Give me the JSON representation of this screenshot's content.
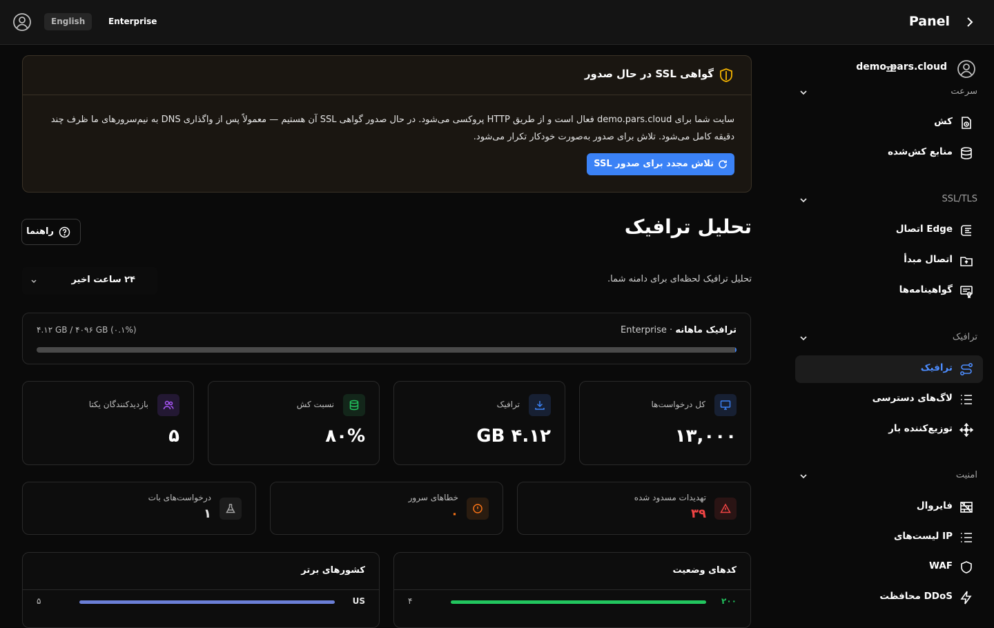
{
  "topbar": {
    "language": "English",
    "plan": "Enterprise",
    "title": "Panel"
  },
  "sidebar": {
    "site": "demo.pars.cloud",
    "sections": [
      {
        "label": "سرعت",
        "items": [
          {
            "label": "کش",
            "icon": "cache-icon"
          },
          {
            "label": "منابع کش‌شده",
            "icon": "database-icon"
          }
        ]
      },
      {
        "label": "SSL/TLS",
        "items": [
          {
            "label": "اتصال Edge",
            "icon": "edge-icon"
          },
          {
            "label": "اتصال مبدأ",
            "icon": "origin-icon"
          },
          {
            "label": "گواهینامه‌ها",
            "icon": "certificate-icon"
          }
        ]
      },
      {
        "label": "ترافیک",
        "items": [
          {
            "label": "ترافیک",
            "icon": "route-icon",
            "active": true
          },
          {
            "label": "لاگ‌های دسترسی",
            "icon": "list-icon"
          },
          {
            "label": "توزیع‌کننده بار",
            "icon": "load-balancer-icon"
          }
        ]
      },
      {
        "label": "امنیت",
        "items": [
          {
            "label": "فایروال",
            "icon": "firewall-icon"
          },
          {
            "label": "لیست‌های IP",
            "icon": "list-icon"
          },
          {
            "label": "WAF",
            "icon": "shield-icon"
          },
          {
            "label": "محافظت DDoS",
            "icon": "bolt-icon"
          }
        ]
      }
    ]
  },
  "banner": {
    "title": "گواهی SSL در حال صدور",
    "text": "سایت شما برای demo.pars.cloud فعال است و از طریق HTTP پروکسی می‌شود. در حال صدور گواهی SSL آن هستیم — معمولاً پس از واگذاری DNS به نیم‌سرورهای ما ظرف چند دقیقه کامل می‌شود. تلاش برای صدور به‌صورت خودکار تکرار می‌شود.",
    "button": "تلاش مجدد برای صدور SSL"
  },
  "page": {
    "title": "تحلیل ترافیک",
    "subtitle": "تحلیل ترافیک لحظه‌ای برای دامنه شما.",
    "guide": "راهنما",
    "range": "۲۴ ساعت اخیر"
  },
  "usage": {
    "title": "ترافیک ماهانه",
    "plan": "Enterprise",
    "value": "۴.۱۲ GB / ۴۰۹۶ GB (۰.۱%)",
    "fraction": 0.001
  },
  "stats": [
    {
      "label": "کل درخواست‌ها",
      "value": "۱۳,۰۰۰",
      "icon": "monitor-icon",
      "color": "#3b82f6"
    },
    {
      "label": "ترافیک",
      "value": "۴.۱۲ GB",
      "icon": "download-icon",
      "color": "#3b82f6"
    },
    {
      "label": "نسبت کش",
      "value": "۸۰%",
      "icon": "database-icon",
      "color": "#22c55e"
    },
    {
      "label": "بازدیدکنندگان یکتا",
      "value": "۵",
      "icon": "users-icon",
      "color": "#a855f7"
    }
  ],
  "stats2": [
    {
      "label": "تهدیدات مسدود شده",
      "value": "۳۹",
      "icon": "warning-icon",
      "color": "#ef4444"
    },
    {
      "label": "خطاهای سرور",
      "value": "۰",
      "icon": "alert-circle-icon",
      "color": "#f97316"
    },
    {
      "label": "درخواست‌های بات",
      "value": "۱",
      "icon": "flask-icon",
      "color": "#a3a3a3"
    }
  ],
  "status_codes": {
    "title": "کدهای وضعیت",
    "rows": [
      {
        "key": "۲۰۰",
        "count": "۴",
        "color": "#22c55e"
      }
    ]
  },
  "countries": {
    "title": "کشورهای برتر",
    "rows": [
      {
        "key": "US",
        "count": "۵",
        "color": "#6b7fd7"
      }
    ]
  }
}
